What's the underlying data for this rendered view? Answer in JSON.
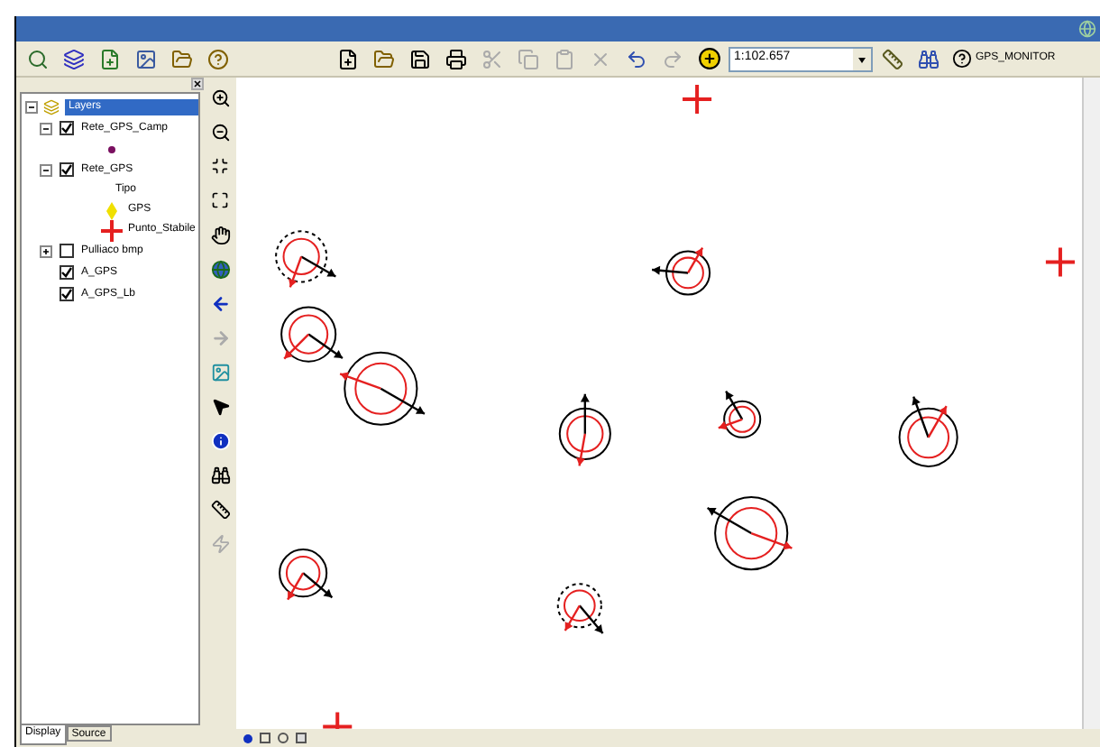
{
  "toolbar": {
    "scale": "1:102.657",
    "monitor_button": "GPS_MONITOR"
  },
  "toc": {
    "root": {
      "label": "Layers",
      "selected": true,
      "expanded": true,
      "children": [
        {
          "label": "Rete_GPS_Camp",
          "checked": true,
          "expanded": true,
          "legend": [
            {
              "kind": "dot"
            }
          ]
        },
        {
          "label": "Rete_GPS",
          "checked": true,
          "expanded": true,
          "legend": [
            {
              "kind": "heading",
              "label": "Tipo"
            },
            {
              "kind": "diamond",
              "label": "GPS"
            },
            {
              "kind": "cross",
              "label": "Punto_Stabile"
            }
          ]
        },
        {
          "label": "Pulliaco bmp",
          "checked": false,
          "expanded": false
        },
        {
          "label": "A_GPS",
          "checked": true
        },
        {
          "label": "A_GPS_Lb",
          "checked": true
        }
      ]
    }
  },
  "tabs": [
    {
      "label": "Display",
      "selected": true
    },
    {
      "label": "Source",
      "selected": false
    }
  ]
}
